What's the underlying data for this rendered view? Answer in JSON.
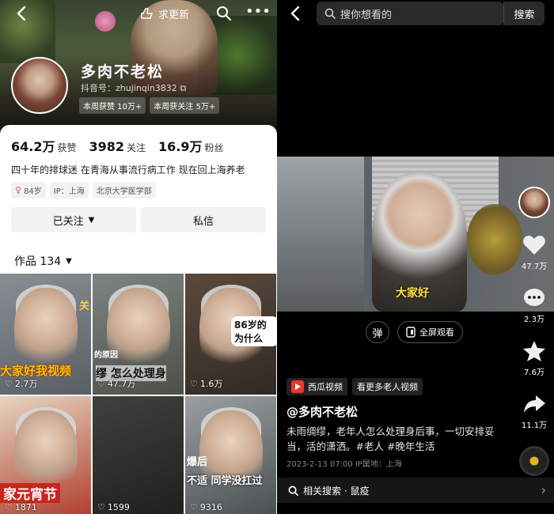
{
  "left": {
    "header": {
      "update_label": "求更新"
    },
    "profile": {
      "name": "多肉不老松",
      "douyin_id": "抖音号：zhujinqin3832",
      "badges": [
        "本周获赞 10万+",
        "本周获关注 5万+"
      ]
    },
    "stats": [
      {
        "num": "64.2万",
        "label": "获赞"
      },
      {
        "num": "3982",
        "label": "关注"
      },
      {
        "num": "16.9万",
        "label": "粉丝"
      }
    ],
    "bio": "四十年的排球迷 在青海从事流行病工作 现在回上海养老",
    "tags": [
      "84岁",
      "IP：上海",
      "北京大学医学部"
    ],
    "actions": {
      "follow": "已关注",
      "message": "私信"
    },
    "works_label": "作品 134",
    "tiles": [
      {
        "caption": "大家好我视频",
        "side": "关",
        "likes": "2.7万"
      },
      {
        "caption": "缪 怎么处理身",
        "side": "的原因",
        "likes": "47.7万"
      },
      {
        "caption": "86岁的 为什么",
        "side": "",
        "likes": "1.6万"
      },
      {
        "caption": "家元宵节",
        "side": "",
        "likes": "1871"
      },
      {
        "caption": "",
        "side": "",
        "likes": "1599"
      },
      {
        "caption": "不适 同学没扛过",
        "side": "爆后",
        "likes": "9316"
      }
    ]
  },
  "right": {
    "search": {
      "placeholder": "搜你想看的",
      "button": "搜索"
    },
    "video": {
      "subtitle": "大家好"
    },
    "controls": {
      "danmu": "弹",
      "fullscreen": "全屏观看"
    },
    "side": {
      "likes": "47.7万",
      "comments": "2.3万",
      "favorites": "7.6万",
      "shares": "11.1万"
    },
    "source": {
      "app": "西瓜视频",
      "more": "看更多老人视频"
    },
    "author": "@多肉不老松",
    "desc": "未雨绸缪，老年人怎么处理身后事，一切安排妥当，活的潇洒。#老人 #晚年生活",
    "meta": "2023-2-13 07:00  IP属地：上海",
    "related": "相关搜索 · 鼠疫"
  }
}
